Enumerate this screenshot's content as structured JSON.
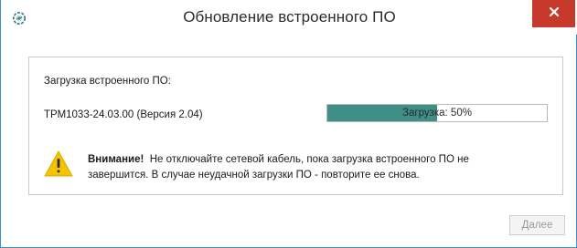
{
  "window": {
    "title": "Обновление встроенного ПО",
    "accent_color": "#3c8fcf",
    "close_button_color": "#c7392b",
    "app_icon": "gear-refresh-icon",
    "close_icon": "close-icon"
  },
  "main": {
    "loading_label": "Загрузка встроенного ПО:",
    "firmware_name": "ТРМ1033-24.03.00 (Версия 2.04)",
    "progress": {
      "value_percent": 50,
      "text": "Загрузка: 50%",
      "fill_color": "#3f8f86"
    },
    "warning": {
      "icon": "warning-icon",
      "title": "Внимание!",
      "message": "Не отключайте сетевой кабель, пока загрузка встроенного ПО не завершится. В случае неудачной загрузки ПО - повторите ее снова."
    }
  },
  "footer": {
    "next_label": "Далее"
  }
}
